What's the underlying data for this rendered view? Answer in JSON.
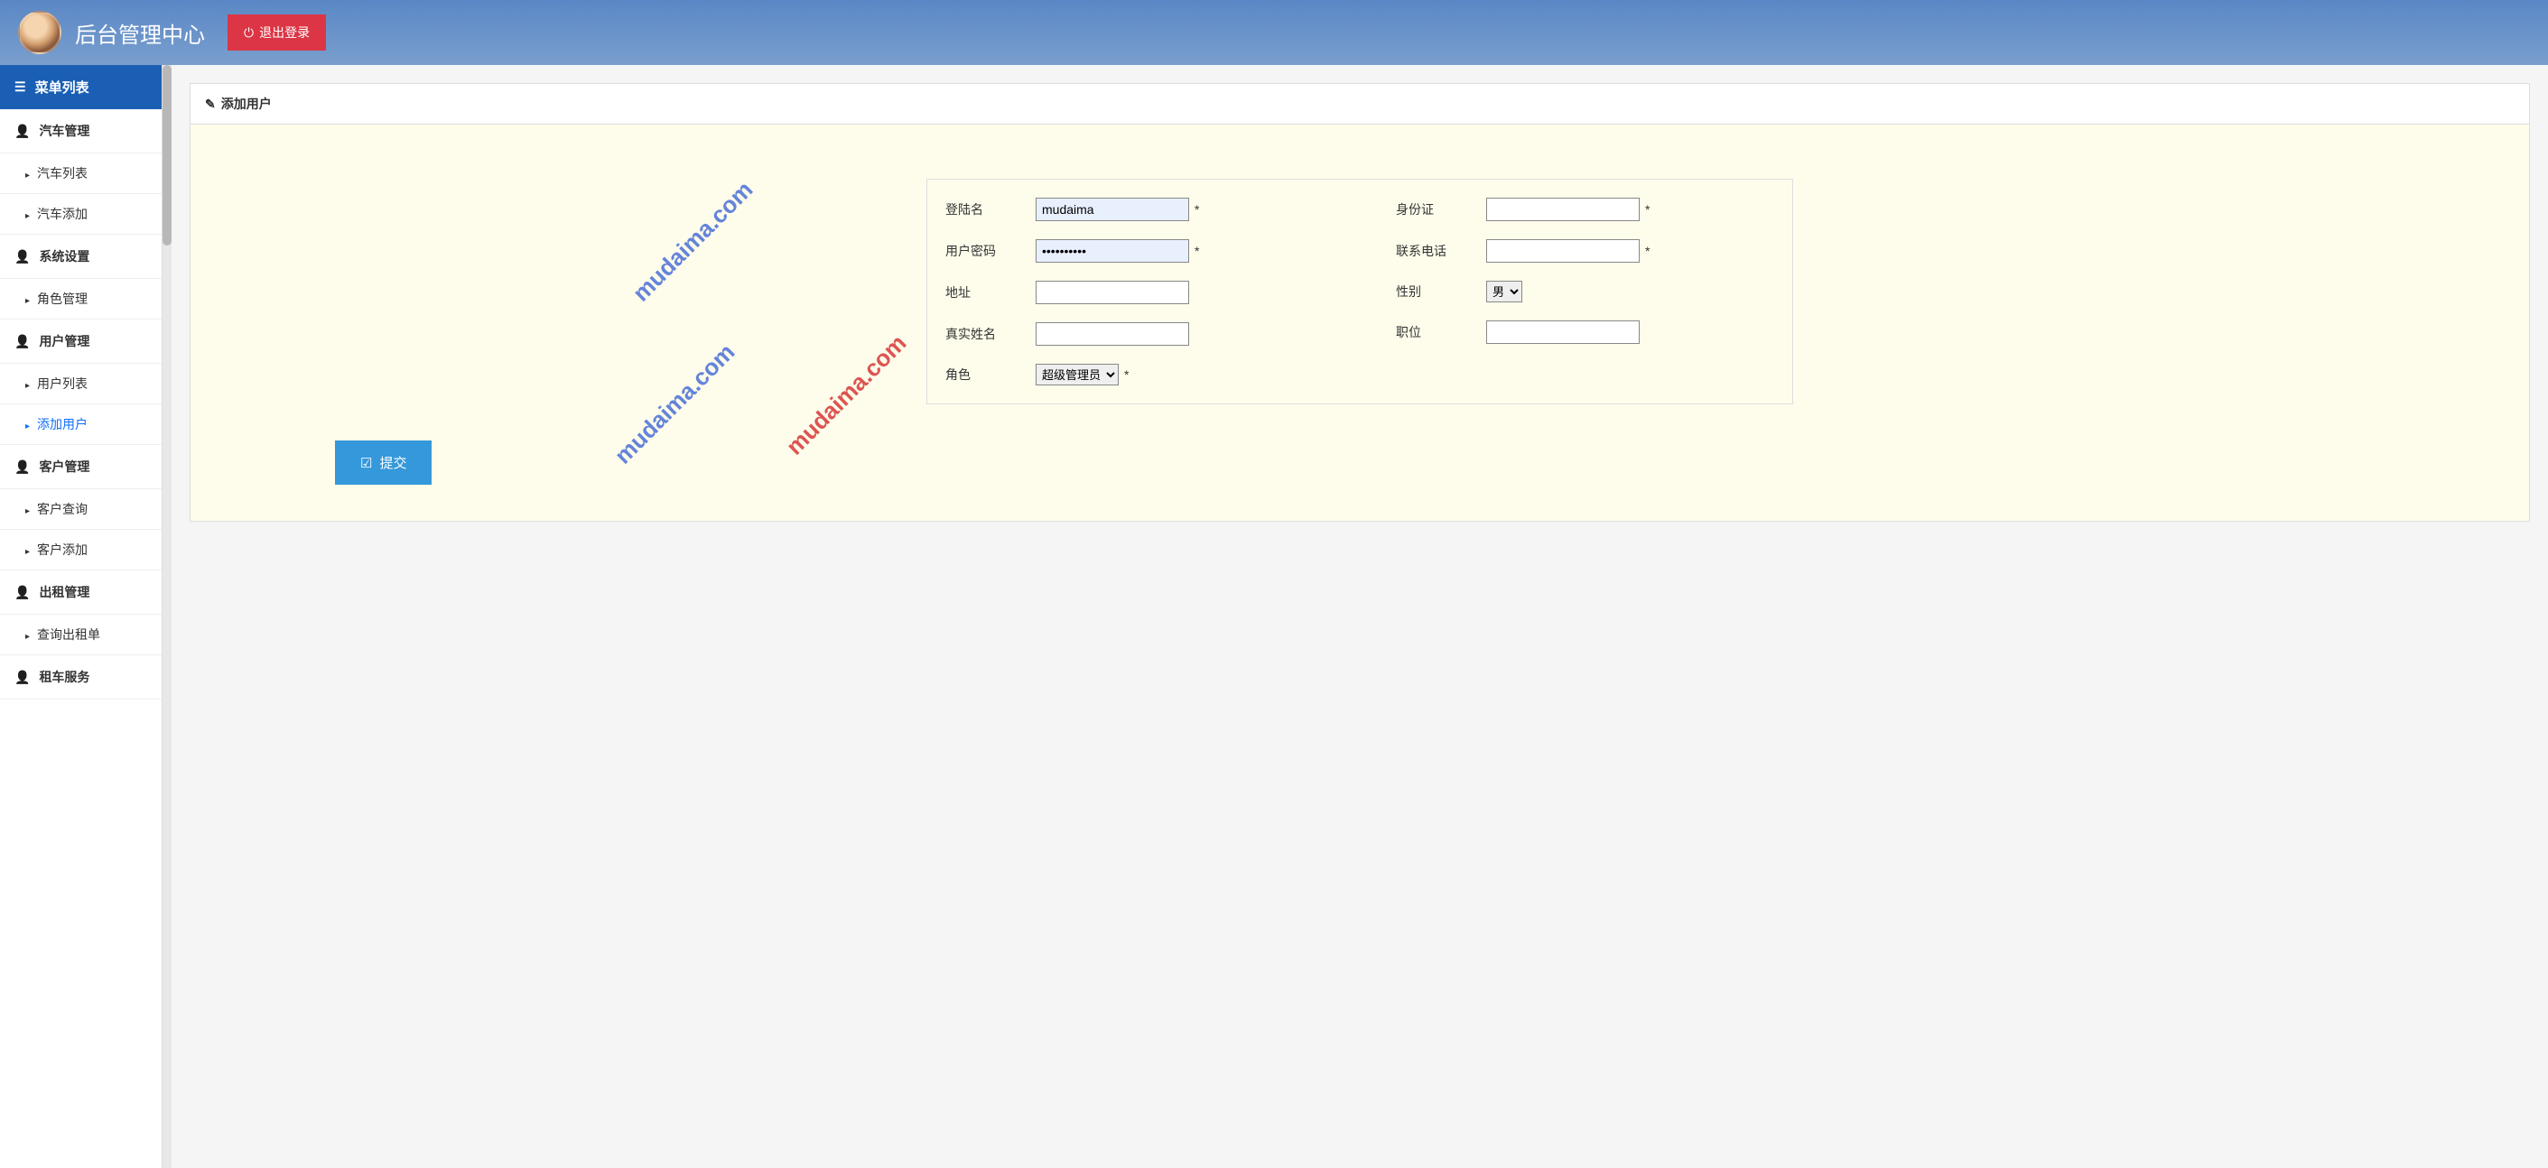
{
  "header": {
    "title": "后台管理中心",
    "logout_label": "退出登录"
  },
  "sidebar": {
    "menu_header": "菜单列表",
    "groups": [
      {
        "label": "汽车管理",
        "items": [
          {
            "label": "汽车列表"
          },
          {
            "label": "汽车添加"
          }
        ]
      },
      {
        "label": "系统设置",
        "items": [
          {
            "label": "角色管理"
          }
        ]
      },
      {
        "label": "用户管理",
        "items": [
          {
            "label": "用户列表"
          },
          {
            "label": "添加用户",
            "active": true
          }
        ]
      },
      {
        "label": "客户管理",
        "items": [
          {
            "label": "客户查询"
          },
          {
            "label": "客户添加"
          }
        ]
      },
      {
        "label": "出租管理",
        "items": [
          {
            "label": "查询出租单"
          }
        ]
      },
      {
        "label": "租车服务",
        "items": []
      }
    ]
  },
  "panel": {
    "title": "添加用户"
  },
  "form": {
    "login_name": {
      "label": "登陆名",
      "value": "mudaima",
      "required": "*"
    },
    "password": {
      "label": "用户密码",
      "value": "••••••••••",
      "required": "*"
    },
    "address": {
      "label": "地址",
      "value": ""
    },
    "real_name": {
      "label": "真实姓名",
      "value": ""
    },
    "role": {
      "label": "角色",
      "selected": "超级管理员",
      "required": "*"
    },
    "id_card": {
      "label": "身份证",
      "value": "",
      "required": "*"
    },
    "phone": {
      "label": "联系电话",
      "value": "",
      "required": "*"
    },
    "gender": {
      "label": "性别",
      "selected": "男"
    },
    "position": {
      "label": "职位",
      "value": ""
    },
    "submit_label": "提交"
  },
  "watermark": {
    "text": "mudaima.com"
  }
}
